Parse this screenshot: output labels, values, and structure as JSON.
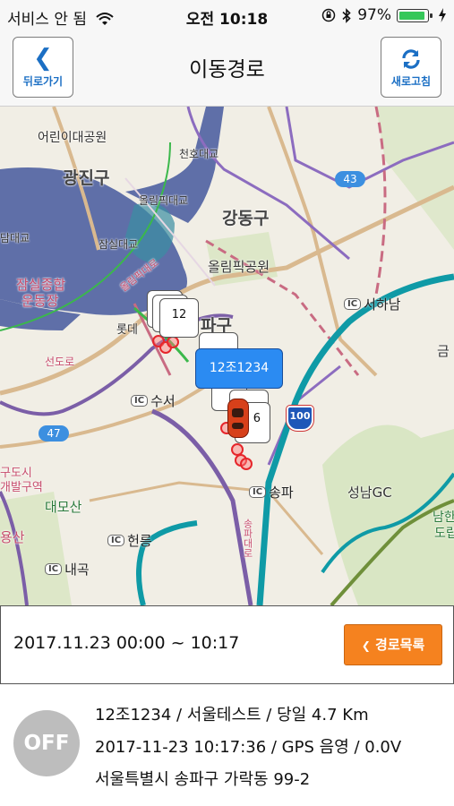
{
  "status_bar": {
    "carrier": "서비스 안 됨",
    "time": "오전 10:18",
    "battery_text": "97%",
    "battery_level": 0.97,
    "icons": [
      "wifi-icon",
      "rotation-lock-icon",
      "bluetooth-icon",
      "battery-icon",
      "charging-icon"
    ]
  },
  "navbar": {
    "back_label": "뒤로가기",
    "title": "이동경로",
    "refresh_label": "새로고침"
  },
  "map": {
    "district_labels": [
      "광진구",
      "강동구",
      "파구"
    ],
    "place_labels": [
      "어린이대공원",
      "천호대교",
      "올림픽대교",
      "잠실대교",
      "담대교",
      "올림픽공원",
      "잠실종합",
      "운동장",
      "롯데",
      "대모산",
      "대모산",
      "용산",
      "대모산"
    ],
    "places": {
      "childrens_park": "어린이대공원",
      "cheonho_bridge": "천호대교",
      "olympic_bridge": "올림픽대교",
      "jamsil_bridge": "잠실대교",
      "dam_bridge": "담대교",
      "olympic_park": "올림픽공원",
      "sports_complex_1": "잠실종합",
      "sports_complex_2": "운동장",
      "lotte": "롯데",
      "daemosan": "대모산",
      "city_1": "구도시",
      "city_2": "개발구역",
      "yongsan": "용산",
      "seongnam_gc": "성남GC",
      "namhan_1": "남한",
      "namhan_2": "도립",
      "geum": "금",
      "road_1": "올림픽대로",
      "road_2": "선도로",
      "road_3": "송파대로"
    },
    "ic_labels": {
      "seohanam": "서하남",
      "suseo": "수서",
      "songpa": "송파",
      "heolleung": "헌릉",
      "naegok": "내곡"
    },
    "ic_badge": "IC",
    "shields": {
      "s43": "43",
      "s47": "47",
      "s100": "100"
    },
    "callout_count": "12",
    "callout_count_2": "6",
    "vehicle_label": "12조1234"
  },
  "datebar": {
    "date_range": "2017.11.23 00:00 ~ 10:17",
    "route_list_label": "경로목록"
  },
  "info": {
    "engine_status": "OFF",
    "line1": "12조1234 / 서울테스트 / 당일 4.7 Km",
    "line2": "2017-11-23 10:17:36 / GPS 음영 / 0.0V",
    "line3": "서울특별시 송파구 가락동 99-2"
  },
  "colors": {
    "accent_blue": "#1b6fc4",
    "route_button": "#f5821f",
    "vehicle_label_bg": "#2b8bf2",
    "off_badge": "#bdbdbd"
  }
}
